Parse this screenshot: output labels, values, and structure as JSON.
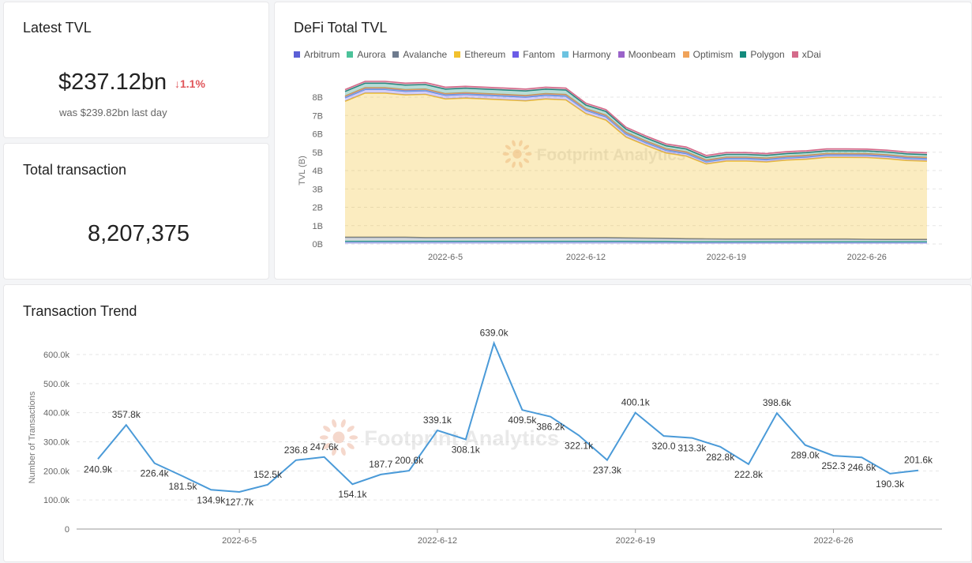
{
  "latest_tvl": {
    "title": "Latest TVL",
    "value": "$237.12bn",
    "change": "1.1%",
    "change_arrow": "↓",
    "previous": "was $239.82bn  last day"
  },
  "total_transaction": {
    "title": "Total transaction",
    "value": "8,207,375"
  },
  "watermark": "Footprint Analytics",
  "chart_data": [
    {
      "type": "area",
      "title": "DeFi Total TVL",
      "ylabel": "TVL (B)",
      "ylim": [
        0,
        8
      ],
      "yticks": [
        "0B",
        "1B",
        "2B",
        "3B",
        "4B",
        "5B",
        "6B",
        "7B",
        "8B"
      ],
      "x_tick_labels": [
        "2022-6-5",
        "2022-6-12",
        "2022-6-19",
        "2022-6-26"
      ],
      "x_dates": [
        "2022-5-31",
        "2022-6-1",
        "2022-6-2",
        "2022-6-3",
        "2022-6-4",
        "2022-6-5",
        "2022-6-6",
        "2022-6-7",
        "2022-6-8",
        "2022-6-9",
        "2022-6-10",
        "2022-6-11",
        "2022-6-12",
        "2022-6-13",
        "2022-6-14",
        "2022-6-15",
        "2022-6-16",
        "2022-6-17",
        "2022-6-18",
        "2022-6-19",
        "2022-6-20",
        "2022-6-21",
        "2022-6-22",
        "2022-6-23",
        "2022-6-24",
        "2022-6-25",
        "2022-6-26",
        "2022-6-27",
        "2022-6-28",
        "2022-6-29"
      ],
      "legend_position": "top",
      "grid": true,
      "series": [
        {
          "name": "Arbitrum",
          "color": "#5b5fd6",
          "values": [
            0.12,
            0.12,
            0.12,
            0.12,
            0.12,
            0.12,
            0.12,
            0.12,
            0.12,
            0.12,
            0.12,
            0.12,
            0.12,
            0.12,
            0.12,
            0.11,
            0.11,
            0.1,
            0.1,
            0.1,
            0.1,
            0.1,
            0.1,
            0.1,
            0.1,
            0.1,
            0.1,
            0.1,
            0.1,
            0.1
          ]
        },
        {
          "name": "Aurora",
          "color": "#4cc29a",
          "values": [
            0.03,
            0.03,
            0.03,
            0.03,
            0.03,
            0.03,
            0.03,
            0.03,
            0.03,
            0.03,
            0.03,
            0.03,
            0.03,
            0.03,
            0.03,
            0.03,
            0.03,
            0.03,
            0.03,
            0.03,
            0.03,
            0.03,
            0.03,
            0.03,
            0.03,
            0.03,
            0.03,
            0.03,
            0.03,
            0.03
          ]
        },
        {
          "name": "Avalanche",
          "color": "#6e7b8e",
          "values": [
            0.22,
            0.22,
            0.22,
            0.22,
            0.2,
            0.2,
            0.2,
            0.2,
            0.2,
            0.2,
            0.2,
            0.2,
            0.2,
            0.2,
            0.18,
            0.18,
            0.17,
            0.16,
            0.15,
            0.14,
            0.14,
            0.14,
            0.14,
            0.14,
            0.14,
            0.14,
            0.13,
            0.12,
            0.12,
            0.12
          ]
        },
        {
          "name": "Ethereum",
          "color": "#f2c12e",
          "values": [
            7.4,
            7.85,
            7.85,
            7.75,
            7.8,
            7.55,
            7.6,
            7.55,
            7.5,
            7.45,
            7.55,
            7.5,
            6.75,
            6.4,
            5.5,
            5.05,
            4.65,
            4.5,
            4.08,
            4.25,
            4.25,
            4.2,
            4.3,
            4.35,
            4.45,
            4.45,
            4.45,
            4.4,
            4.3,
            4.26
          ]
        },
        {
          "name": "Fantom",
          "color": "#6b5ce7",
          "values": [
            0.2,
            0.2,
            0.2,
            0.2,
            0.2,
            0.2,
            0.2,
            0.2,
            0.2,
            0.2,
            0.2,
            0.2,
            0.18,
            0.18,
            0.16,
            0.15,
            0.14,
            0.14,
            0.12,
            0.12,
            0.12,
            0.12,
            0.12,
            0.12,
            0.12,
            0.12,
            0.12,
            0.12,
            0.12,
            0.12
          ]
        },
        {
          "name": "Harmony",
          "color": "#6cc3e0",
          "values": [
            0.02,
            0.02,
            0.02,
            0.02,
            0.02,
            0.02,
            0.02,
            0.02,
            0.02,
            0.02,
            0.02,
            0.02,
            0.02,
            0.02,
            0.02,
            0.02,
            0.02,
            0.02,
            0.02,
            0.02,
            0.02,
            0.02,
            0.02,
            0.02,
            0.02,
            0.02,
            0.02,
            0.02,
            0.02,
            0.02
          ]
        },
        {
          "name": "Moonbeam",
          "color": "#9a63c9",
          "values": [
            0.05,
            0.05,
            0.05,
            0.05,
            0.05,
            0.05,
            0.05,
            0.05,
            0.05,
            0.05,
            0.05,
            0.05,
            0.05,
            0.05,
            0.05,
            0.05,
            0.05,
            0.05,
            0.05,
            0.05,
            0.05,
            0.05,
            0.05,
            0.05,
            0.05,
            0.05,
            0.05,
            0.05,
            0.05,
            0.05
          ]
        },
        {
          "name": "Optimism",
          "color": "#f0a35a",
          "values": [
            0.02,
            0.02,
            0.02,
            0.02,
            0.02,
            0.02,
            0.02,
            0.02,
            0.02,
            0.02,
            0.02,
            0.02,
            0.02,
            0.02,
            0.02,
            0.02,
            0.02,
            0.02,
            0.02,
            0.02,
            0.02,
            0.02,
            0.02,
            0.02,
            0.02,
            0.02,
            0.02,
            0.02,
            0.02,
            0.02
          ]
        },
        {
          "name": "Polygon",
          "color": "#138a7c",
          "values": [
            0.25,
            0.25,
            0.25,
            0.25,
            0.25,
            0.25,
            0.25,
            0.25,
            0.25,
            0.25,
            0.25,
            0.25,
            0.2,
            0.2,
            0.18,
            0.17,
            0.16,
            0.16,
            0.15,
            0.15,
            0.15,
            0.15,
            0.15,
            0.15,
            0.15,
            0.15,
            0.15,
            0.15,
            0.15,
            0.15
          ]
        },
        {
          "name": "xDai",
          "color": "#d46a8a",
          "values": [
            0.1,
            0.1,
            0.1,
            0.1,
            0.1,
            0.1,
            0.1,
            0.1,
            0.1,
            0.1,
            0.1,
            0.1,
            0.1,
            0.1,
            0.1,
            0.1,
            0.1,
            0.1,
            0.1,
            0.1,
            0.1,
            0.1,
            0.1,
            0.1,
            0.1,
            0.1,
            0.1,
            0.1,
            0.1,
            0.1
          ]
        }
      ]
    },
    {
      "type": "line",
      "title": "Transaction Trend",
      "ylabel": "Number of Transactions",
      "ylim": [
        0,
        600
      ],
      "yticks": [
        "0",
        "100.0k",
        "200.0k",
        "300.0k",
        "400.0k",
        "500.0k",
        "600.0k"
      ],
      "x_tick_labels": [
        "2022-6-5",
        "2022-6-12",
        "2022-6-19",
        "2022-6-26"
      ],
      "x_dates": [
        "2022-5-31",
        "2022-6-1",
        "2022-6-2",
        "2022-6-3",
        "2022-6-4",
        "2022-6-5",
        "2022-6-6",
        "2022-6-7",
        "2022-6-8",
        "2022-6-9",
        "2022-6-10",
        "2022-6-11",
        "2022-6-12",
        "2022-6-13",
        "2022-6-14",
        "2022-6-15",
        "2022-6-16",
        "2022-6-17",
        "2022-6-18",
        "2022-6-19",
        "2022-6-20",
        "2022-6-21",
        "2022-6-22",
        "2022-6-23",
        "2022-6-24",
        "2022-6-25",
        "2022-6-26",
        "2022-6-27",
        "2022-6-28",
        "2022-6-29"
      ],
      "grid": true,
      "series": [
        {
          "color": "#4a9ad8",
          "values": [
            240.9,
            357.8,
            226.4,
            181.5,
            134.9,
            127.7,
            152.5,
            236.8,
            247.6,
            154.1,
            187.7,
            200.6,
            339.1,
            308.1,
            639.0,
            409.5,
            386.2,
            322.1,
            237.3,
            400.1,
            320.0,
            313.3,
            282.8,
            222.8,
            398.6,
            289.0,
            252.3,
            246.6,
            190.3,
            201.6
          ],
          "labels": [
            "240.9k",
            "357.8k",
            "226.4k",
            "181.5k",
            "134.9k",
            "127.7k",
            "152.5k",
            "236.8",
            "247.6k",
            "154.1k",
            "187.7",
            "200.6k",
            "339.1k",
            "308.1k",
            "639.0k",
            "409.5k",
            "386.2k",
            "322.1k",
            "237.3k",
            "400.1k",
            "320.0",
            "313.3k",
            "282.8k",
            "222.8k",
            "398.6k",
            "289.0k",
            "252.3",
            "246.6k",
            "190.3k",
            "201.6k"
          ]
        }
      ]
    }
  ]
}
